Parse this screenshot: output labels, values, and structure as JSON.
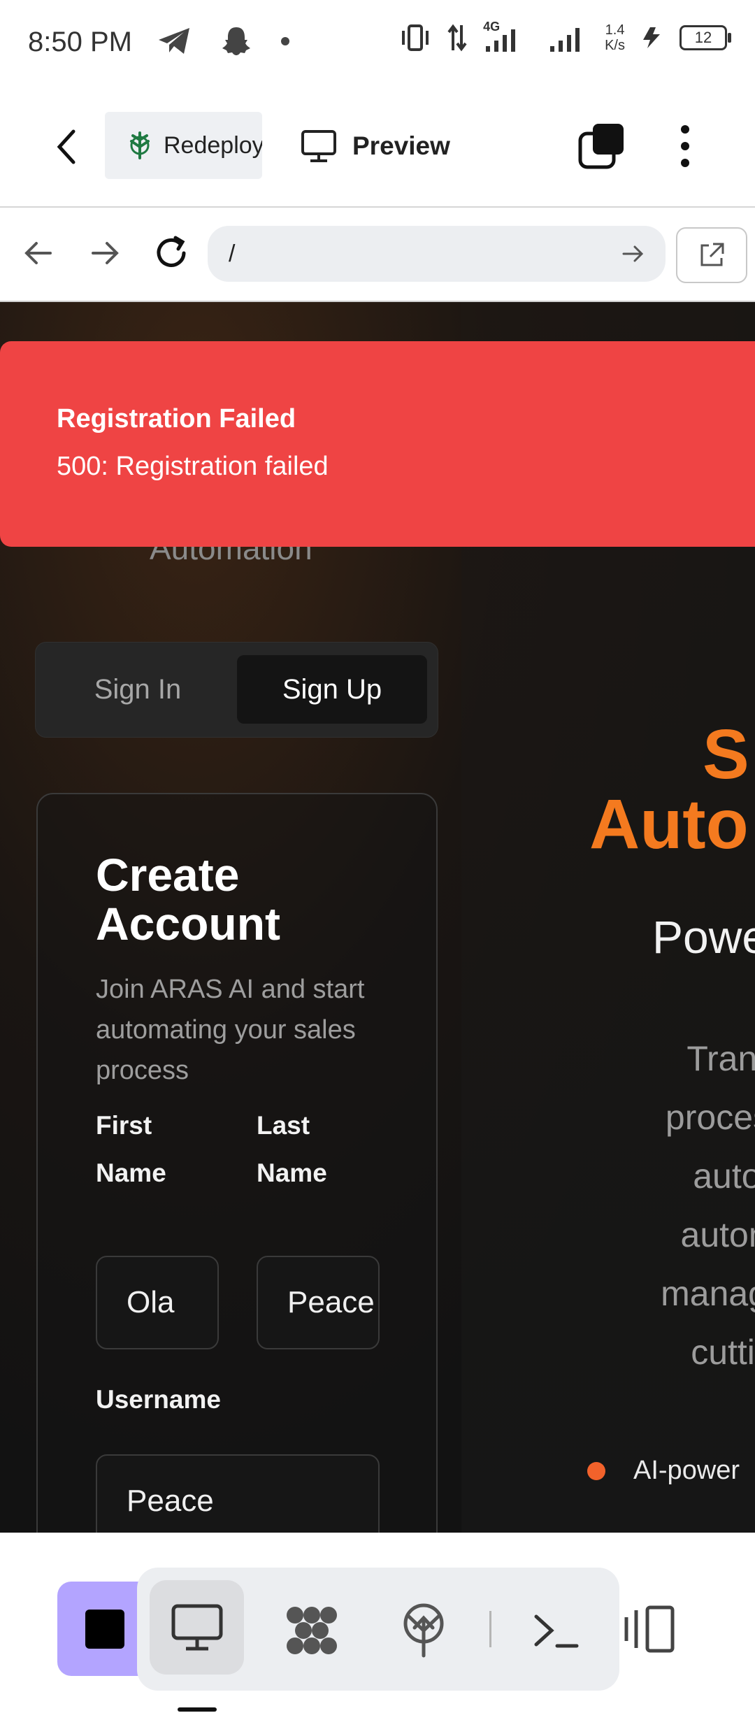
{
  "status_bar": {
    "time": "8:50 PM",
    "net_speed_value": "1.4",
    "net_speed_unit": "K/s",
    "network_type": "4G",
    "battery": "12"
  },
  "app_header": {
    "redeploy_label": "Redeploy",
    "preview_label": "Preview"
  },
  "url_bar": {
    "url": "/"
  },
  "page": {
    "behind_text": "Automation",
    "auth_tabs": {
      "signin": "Sign In",
      "signup": "Sign Up"
    },
    "form": {
      "title": "Create Account",
      "subtitle": "Join ARAS AI and start automating your sales process",
      "first_name_label": "First Name",
      "last_name_label": "Last Name",
      "first_name_value": "Ola",
      "last_name_value": "Peace",
      "username_label": "Username",
      "username_value": "Peace"
    },
    "hero": {
      "title_line1": "S",
      "title_line2": "Auto",
      "subtitle": "Powe",
      "desc_lines": [
        "Transfo",
        "process",
        "automati",
        "automate",
        "manag",
        "cutting-e"
      ],
      "bullet": "AI-power"
    }
  },
  "toast": {
    "title": "Registration Failed",
    "message": "500: Registration failed"
  },
  "colors": {
    "accent_orange": "#f47a1f",
    "toast_red": "#ef4444",
    "stop_purple": "#b3a4ff"
  }
}
